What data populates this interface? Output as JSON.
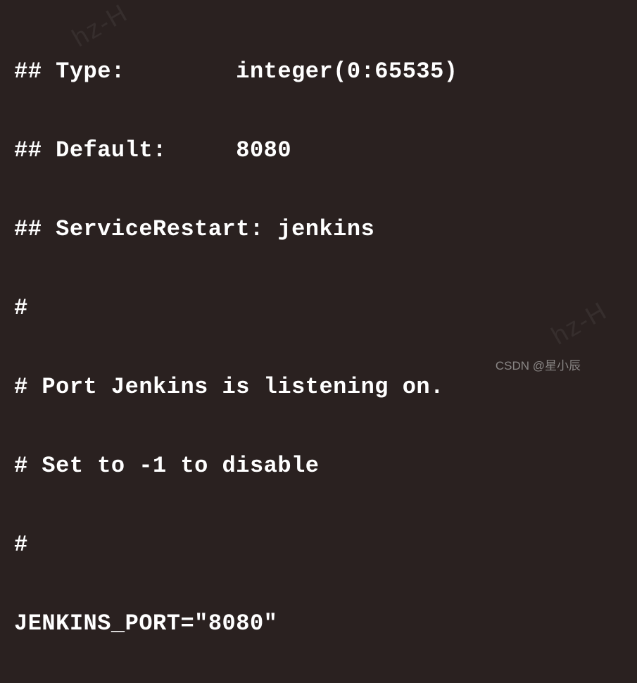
{
  "config": {
    "lines": [
      "## Type:        integer(0:65535)",
      "## Default:     8080",
      "## ServiceRestart: jenkins",
      "#",
      "# Port Jenkins is listening on.",
      "# Set to -1 to disable",
      "#",
      "JENKINS_PORT=\"8080\""
    ]
  },
  "watermark": {
    "bottom": "CSDN @星小辰",
    "diagonal": "hz-H"
  }
}
